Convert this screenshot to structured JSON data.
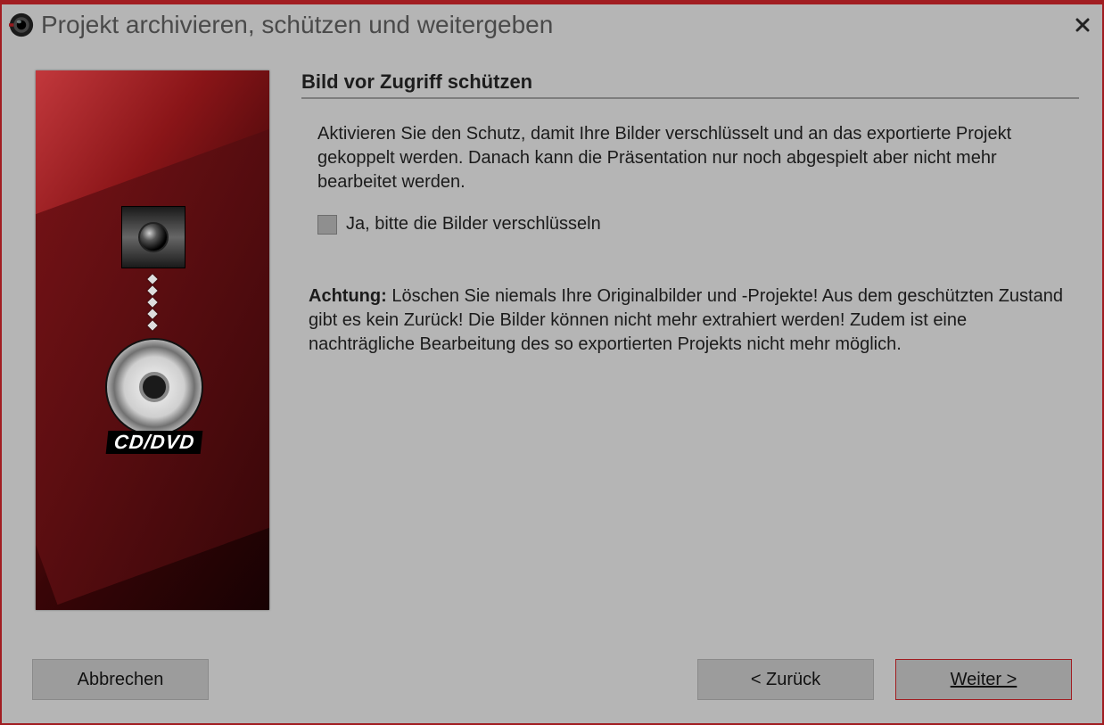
{
  "window": {
    "title": "Projekt archivieren, schützen und weitergeben"
  },
  "hero": {
    "disc_label": "CD/DVD"
  },
  "content": {
    "heading": "Bild vor Zugriff schützen",
    "description": "Aktivieren Sie den Schutz, damit Ihre Bilder verschlüsselt und an das exportierte Projekt gekoppelt werden. Danach kann die Präsentation nur noch abgespielt aber nicht mehr bearbeitet werden.",
    "checkbox_label": "Ja, bitte die Bilder verschlüsseln",
    "warning_lead": "Achtung:",
    "warning_text": " Löschen Sie niemals Ihre Originalbilder und -Projekte! Aus dem geschützten Zustand gibt es kein Zurück! Die Bilder können nicht mehr extrahiert werden! Zudem ist eine nachträgliche Bearbeitung des so exportierten Projekts nicht mehr möglich."
  },
  "footer": {
    "cancel": "Abbrechen",
    "back": "< Zurück",
    "next": "Weiter >"
  }
}
